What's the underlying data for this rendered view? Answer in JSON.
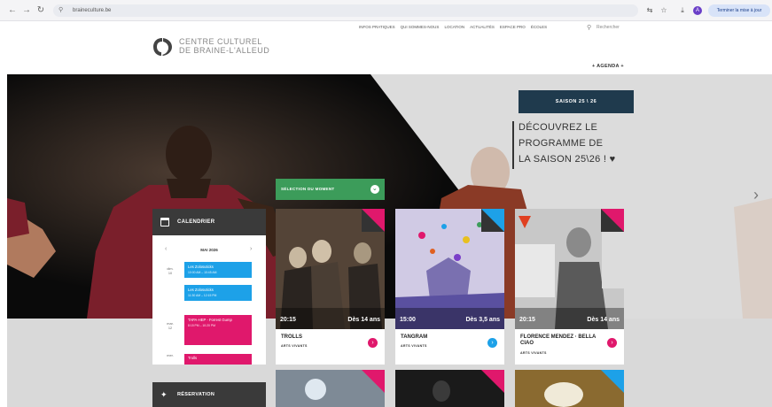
{
  "browser": {
    "url": "brainecuIture.be",
    "finish_button": "Terminer la mise à jour",
    "profile_initial": "A"
  },
  "site": {
    "logo_line1": "CENTRE CULTUREL",
    "logo_line2": "DE BRAINE-L'ALLEUD",
    "nav": [
      "INFOS PRATIQUES",
      "QUI SOMMES-NOUS",
      "LOCATION",
      "ACTUALITÉS",
      "ESPACE PRO",
      "ÉCOLES"
    ],
    "search_label": "Rechercher",
    "agenda_link": "+ AGENDA +"
  },
  "hero": {
    "saison_box": "SAISON 25 \\ 26",
    "saison_text_lines": [
      "DÉCOUVREZ LE",
      "PROGRAMME DE",
      "LA SAISON 25\\26 ! ♥"
    ],
    "selection_label": "SÉLECTION DU MOMENT"
  },
  "calendar": {
    "title": "CALENDRIER",
    "month": "MAI 2026",
    "days": [
      {
        "label": "dim.",
        "num": "10"
      },
      {
        "label": "mar.",
        "num": "12"
      },
      {
        "label": "mer.",
        "num": "13"
      }
    ],
    "events": [
      {
        "title": "Les Zolosuticks",
        "time": "10:00 AM – 10:45 AM",
        "color": "blue"
      },
      {
        "title": "Les Zolosuticks",
        "time": "11:30 AM – 12:15 PM",
        "color": "blue"
      },
      {
        "title": "TAPA-HEP - Forrest Gump",
        "time": "8:15 PM – 10:20 PM",
        "color": "pink"
      },
      {
        "title": "Trolls",
        "time": "",
        "color": "pink"
      }
    ]
  },
  "reservation_label": "RÉSERVATION",
  "cards": [
    {
      "title": "TROLLS",
      "category": "ARTS VIVANTS",
      "time": "20:15",
      "age": "Dès 14 ans",
      "corner": "#e0186c",
      "go": "#e0186c"
    },
    {
      "title": "TANGRAM",
      "category": "ARTS VIVANTS",
      "time": "15:00",
      "age": "Dès 3,5 ans",
      "corner": "#1da1e8",
      "go": "#1da1e8"
    },
    {
      "title": "FLORENCE MENDEZ · BELLA CIAO",
      "category": "ARTS VIVANTS",
      "time": "20:15",
      "age": "Dès 14 ans",
      "corner": "#e0186c",
      "go": "#e0186c"
    }
  ],
  "colors": {
    "accent_pink": "#e0186c",
    "accent_blue": "#1da1e8",
    "dark": "#3a3a3a",
    "navy": "#1f3a4d",
    "green": "#3c9c5a"
  }
}
